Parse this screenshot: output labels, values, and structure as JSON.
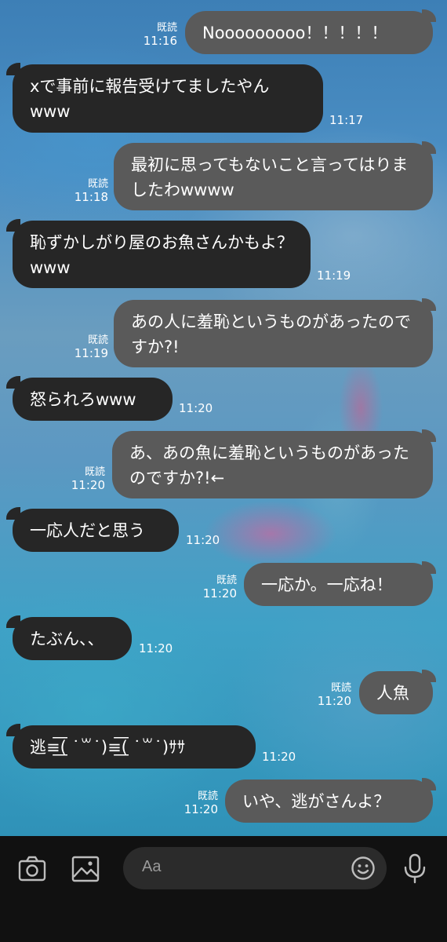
{
  "messages": [
    {
      "dir": "out",
      "text": "Nooooooooo！！！！！",
      "read": "既読",
      "time": "11:16"
    },
    {
      "dir": "in",
      "text": "xで事前に報告受けてましたやんwww",
      "time": "11:17"
    },
    {
      "dir": "out",
      "text": "最初に思ってもないこと言ってはりましたわwwww",
      "read": "既読",
      "time": "11:18"
    },
    {
      "dir": "in",
      "text": "恥ずかしがり屋のお魚さんかもよ？www",
      "time": "11:19"
    },
    {
      "dir": "out",
      "text": "あの人に羞恥というものがあったのですか?!",
      "read": "既読",
      "time": "11:19"
    },
    {
      "dir": "in",
      "text": "怒られろwww",
      "time": "11:20"
    },
    {
      "dir": "out",
      "text": "あ、あの魚に羞恥というものがあったのですか?!←",
      "read": "既読",
      "time": "11:20"
    },
    {
      "dir": "in",
      "text": "一応人だと思う",
      "time": "11:20"
    },
    {
      "dir": "out",
      "text": "一応か。一応ね！",
      "read": "既読",
      "time": "11:20"
    },
    {
      "dir": "in",
      "text": "たぶん、、",
      "time": "11:20"
    },
    {
      "dir": "out",
      "text": "人魚",
      "read": "既読",
      "time": "11:20"
    },
    {
      "dir": "in",
      "text": "逃≡͟͟͞͞( ˙꒳˙)≡͟͟͞͞( ˙꒳˙)ｻｻ",
      "time": "11:20"
    },
    {
      "dir": "out",
      "text": "いや、逃がさんよ？",
      "read": "既読",
      "time": "11:20"
    }
  ],
  "input": {
    "placeholder": "Aa"
  },
  "icons": {
    "camera": "camera-icon",
    "image": "image-icon",
    "emoji": "emoji-icon",
    "mic": "microphone-icon"
  },
  "colors": {
    "incoming_bubble": "#262626",
    "outgoing_bubble": "#5a5a5a",
    "bottom_bar": "#111111"
  }
}
